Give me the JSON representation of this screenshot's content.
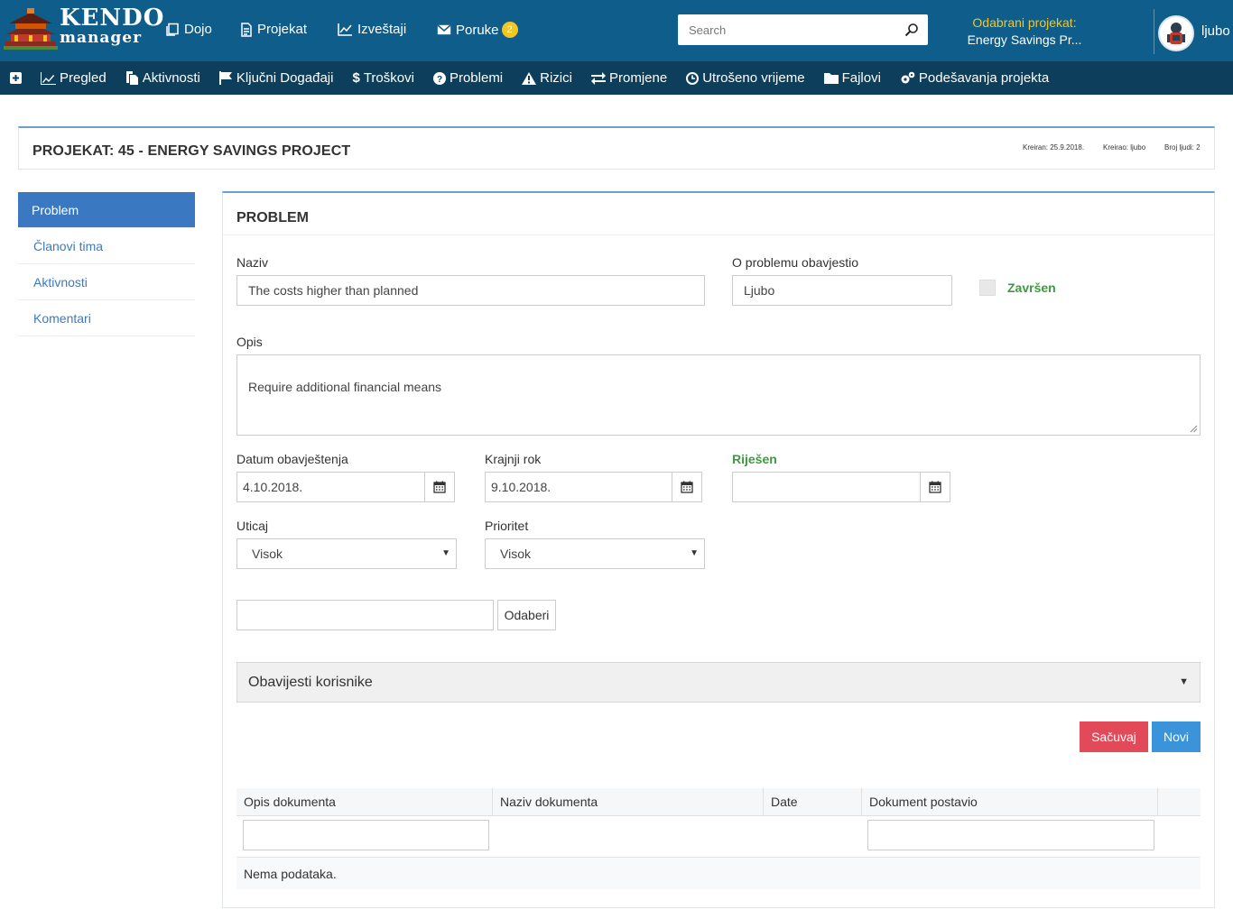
{
  "app": {
    "logo_top": "KENDO",
    "logo_bottom": "manager"
  },
  "topnav": {
    "items": [
      {
        "label": "Dojo",
        "icon": "copy-icon"
      },
      {
        "label": "Projekat",
        "icon": "file-icon"
      },
      {
        "label": "Izveštaji",
        "icon": "chart-icon"
      },
      {
        "label": "Poruke",
        "icon": "envelope-icon",
        "badge": "2"
      }
    ]
  },
  "search": {
    "placeholder": "Search"
  },
  "selected_project": {
    "label": "Odabrani projekat:",
    "value": "Energy Savings Pr..."
  },
  "user": {
    "name": "ljubo"
  },
  "subnav": {
    "items": [
      {
        "label": "Pregled",
        "icon": "line-chart-icon"
      },
      {
        "label": "Aktivnosti",
        "icon": "files-icon"
      },
      {
        "label": "Ključni Događaji",
        "icon": "flag-icon"
      },
      {
        "label": "Troškovi",
        "icon": "dollar-icon"
      },
      {
        "label": "Problemi",
        "icon": "question-circle-icon"
      },
      {
        "label": "Rizici",
        "icon": "warning-icon"
      },
      {
        "label": "Promjene",
        "icon": "exchange-icon"
      },
      {
        "label": "Utrošeno vrijeme",
        "icon": "clock-icon"
      },
      {
        "label": "Fajlovi",
        "icon": "folder-icon"
      },
      {
        "label": "Podešavanja projekta",
        "icon": "gears-icon"
      }
    ]
  },
  "project": {
    "title": "PROJEKAT: 45 - ENERGY SAVINGS PROJECT",
    "created": "Kreiran: 25.9.2018.",
    "created_by": "Kreirao: ljubo",
    "people": "Broj ljudi: 2"
  },
  "sidemenu": {
    "items": [
      {
        "label": "Problem"
      },
      {
        "label": "Članovi tima"
      },
      {
        "label": "Aktivnosti"
      },
      {
        "label": "Komentari"
      }
    ]
  },
  "problem": {
    "title": "PROBLEM",
    "naziv_label": "Naziv",
    "naziv_value": "The costs higher than planned",
    "reporter_label": "O problemu obavjestio",
    "reporter_value": "Ljubo",
    "done_label": "Završen",
    "opis_label": "Opis",
    "opis_value": "Require additional financial means",
    "datum_label": "Datum obavještenja",
    "datum_value": "4.10.2018.",
    "rok_label": "Krajnji rok",
    "rok_value": "9.10.2018.",
    "rijesen_label": "Riješen",
    "rijesen_value": "",
    "uticaj_label": "Uticaj",
    "uticaj_value": "Visok",
    "prioritet_label": "Prioritet",
    "prioritet_value": "Visok",
    "odaberi_label": "Odaberi",
    "notify_label": "Obavijesti korisnike",
    "save_label": "Sačuvaj",
    "new_label": "Novi"
  },
  "docs": {
    "columns": [
      "Opis dokumenta",
      "Naziv dokumenta",
      "Date",
      "Dokument postavio"
    ],
    "empty": "Nema podataka."
  },
  "colors": {
    "topbar": "#0f5d8a",
    "subnav": "#0d3f5c",
    "accent": "#3a78c2",
    "save": "#e24a5a",
    "new": "#3b94d9",
    "badge": "#f3c623",
    "green": "#3e9a3e"
  }
}
